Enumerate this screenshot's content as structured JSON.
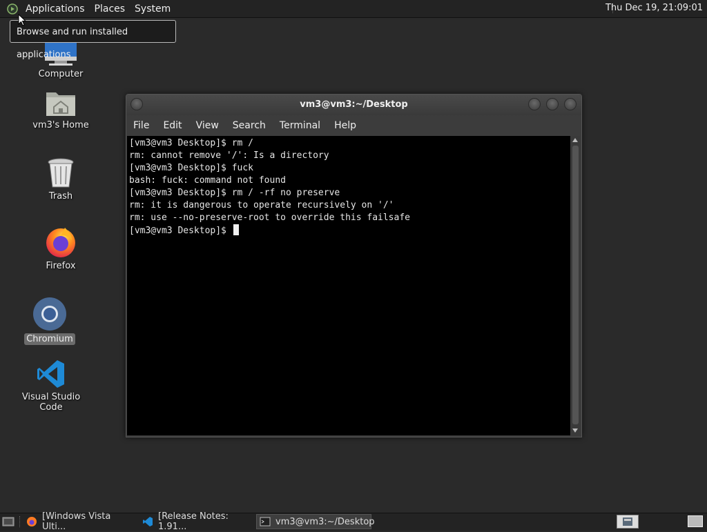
{
  "top_panel": {
    "menus": [
      "Applications",
      "Places",
      "System"
    ],
    "clock": "Thu Dec 19, 21:09:01"
  },
  "tooltip": "Browse and run installed applications",
  "desktop_icons": [
    {
      "label": "Computer",
      "icon": "computer-icon"
    },
    {
      "label": "vm3's Home",
      "icon": "home-folder-icon"
    },
    {
      "label": "Trash",
      "icon": "trash-icon"
    },
    {
      "label": "Firefox",
      "icon": "firefox-icon"
    },
    {
      "label": "Chromium",
      "icon": "chromium-icon"
    },
    {
      "label": "Visual Studio Code",
      "icon": "vscode-icon"
    }
  ],
  "terminal": {
    "title": "vm3@vm3:~/Desktop",
    "menu": [
      "File",
      "Edit",
      "View",
      "Search",
      "Terminal",
      "Help"
    ],
    "lines": [
      "[vm3@vm3 Desktop]$ rm /",
      "rm: cannot remove '/': Is a directory",
      "[vm3@vm3 Desktop]$ fuck",
      "bash: fuck: command not found",
      "[vm3@vm3 Desktop]$ rm / -rf no preserve",
      "rm: it is dangerous to operate recursively on '/'",
      "rm: use --no-preserve-root to override this failsafe"
    ],
    "prompt": "[vm3@vm3 Desktop]$ "
  },
  "taskbar": {
    "tasks": [
      {
        "label": "[Windows Vista Ulti...",
        "icon": "firefox-icon"
      },
      {
        "label": "[Release Notes: 1.91...",
        "icon": "vscode-icon"
      },
      {
        "label": "vm3@vm3:~/Desktop",
        "icon": "terminal-icon",
        "active": true
      }
    ]
  }
}
